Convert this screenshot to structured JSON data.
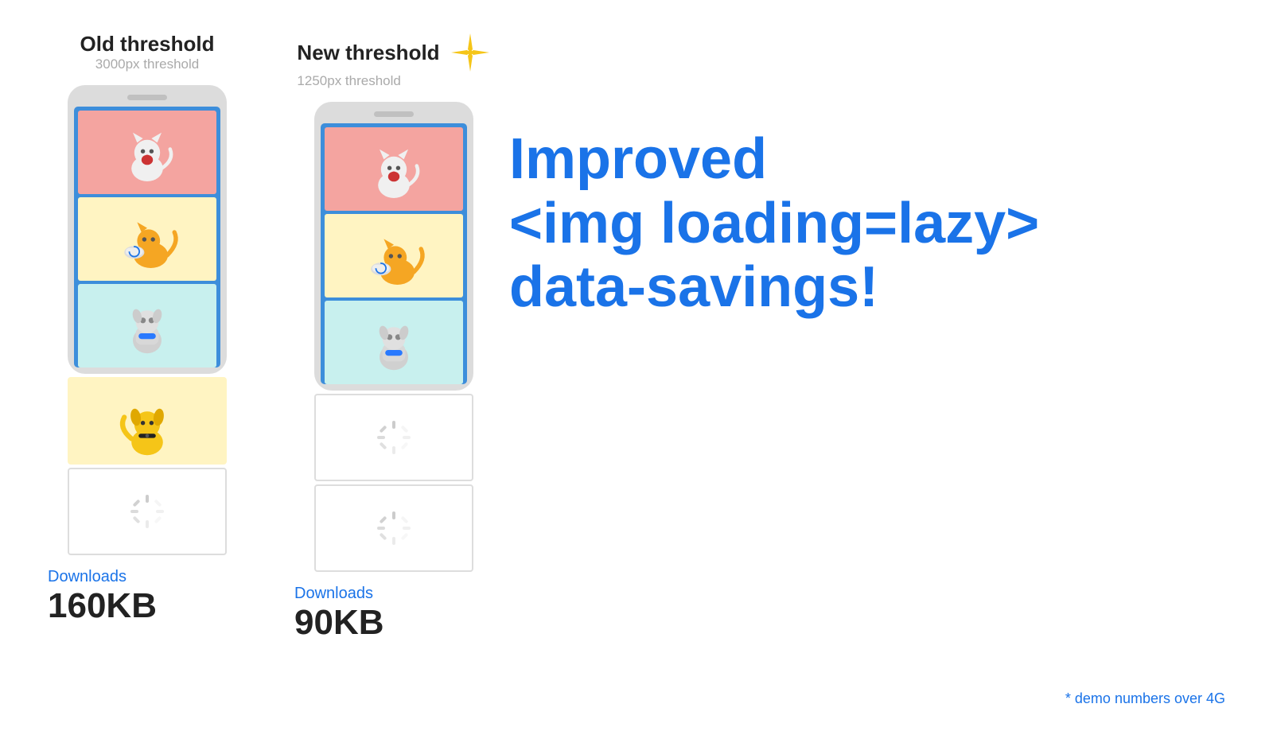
{
  "old_threshold": {
    "title": "Old threshold",
    "subtitle": "3000px threshold",
    "downloads_label": "Downloads",
    "downloads_size": "160KB"
  },
  "new_threshold": {
    "title": "New threshold",
    "subtitle": "1250px threshold",
    "downloads_label": "Downloads",
    "downloads_size": "90KB"
  },
  "hero": {
    "line1": "Improved",
    "line2": "<img loading=lazy>",
    "line3": "data-savings!"
  },
  "demo_note": "* demo numbers over 4G",
  "colors": {
    "blue_label": "#1a73e8",
    "phone_bg": "#dcdcdc",
    "phone_screen_bg": "#3d8edb",
    "img1_bg": "#F4A4A0",
    "img2_bg": "#FFF4C2",
    "img3_bg": "#C8F0EE",
    "sparkle_color": "#F5C518"
  },
  "icons": {
    "sparkle": "✦",
    "spinner": "⏳"
  }
}
